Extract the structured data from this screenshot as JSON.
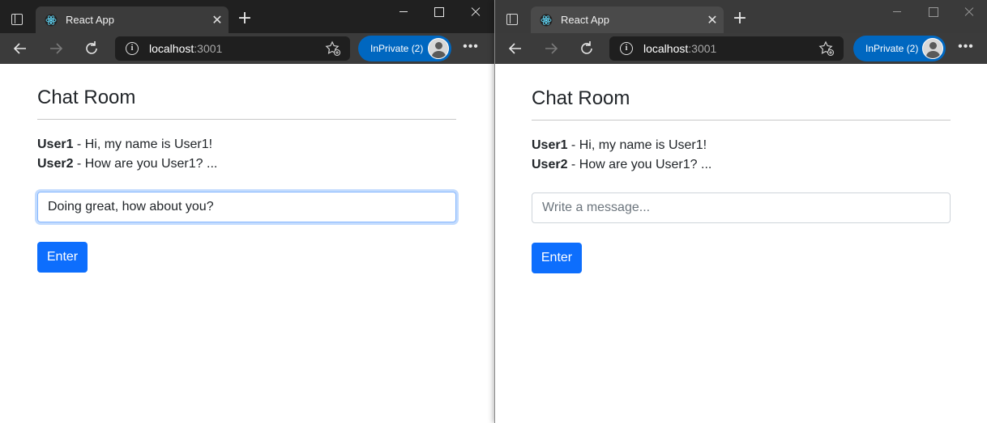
{
  "windows": [
    {
      "tab": {
        "title": "React App",
        "favicon": "react-logo-icon"
      },
      "address": {
        "host": "localhost",
        "port": ":3001"
      },
      "profile": {
        "label": "InPrivate (2)"
      },
      "page": {
        "title": "Chat Room",
        "messages": [
          {
            "user": "User1",
            "text": " - Hi, my name is User1!"
          },
          {
            "user": "User2",
            "text": " - How are you User1? ..."
          }
        ],
        "input": {
          "value": "Doing great, how about you?",
          "placeholder": "Write a message..."
        },
        "button_label": "Enter"
      }
    },
    {
      "tab": {
        "title": "React App",
        "favicon": "react-logo-icon"
      },
      "address": {
        "host": "localhost",
        "port": ":3001"
      },
      "profile": {
        "label": "InPrivate (2)"
      },
      "page": {
        "title": "Chat Room",
        "messages": [
          {
            "user": "User1",
            "text": " - Hi, my name is User1!"
          },
          {
            "user": "User2",
            "text": " - How are you User1? ..."
          }
        ],
        "input": {
          "value": "",
          "placeholder": "Write a message..."
        },
        "button_label": "Enter"
      }
    }
  ],
  "colors": {
    "accent": "#0d6efd",
    "profile": "#0067c0",
    "titlebar": "#202020",
    "toolbar": "#3b3b3b"
  }
}
